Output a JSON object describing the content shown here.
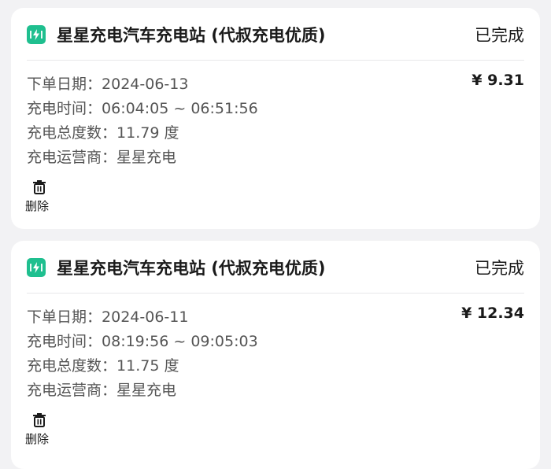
{
  "orders": [
    {
      "station_name": "星星充电汽车充电站 (代叔充电优质)",
      "status": "已完成",
      "price": "¥ 9.31",
      "order_date_label": "下单日期：",
      "order_date": "2024-06-13",
      "charge_time_label": "充电时间：",
      "charge_time": "06:04:05 ~ 06:51:56",
      "total_kwh_label": "充电总度数：",
      "total_kwh": "11.79 度",
      "operator_label": "充电运营商：",
      "operator": "星星充电",
      "delete_label": "删除"
    },
    {
      "station_name": "星星充电汽车充电站 (代叔充电优质)",
      "status": "已完成",
      "price": "¥ 12.34",
      "order_date_label": "下单日期：",
      "order_date": "2024-06-11",
      "charge_time_label": "充电时间：",
      "charge_time": "08:19:56 ~ 09:05:03",
      "total_kwh_label": "充电总度数：",
      "total_kwh": "11.75 度",
      "operator_label": "充电运营商：",
      "operator": "星星充电",
      "delete_label": "删除"
    }
  ],
  "icons": {
    "station": "charging-bolt-icon",
    "delete": "trash-icon"
  },
  "colors": {
    "accent": "#1fbf8f",
    "background": "#f2f2f4",
    "card": "#ffffff"
  }
}
